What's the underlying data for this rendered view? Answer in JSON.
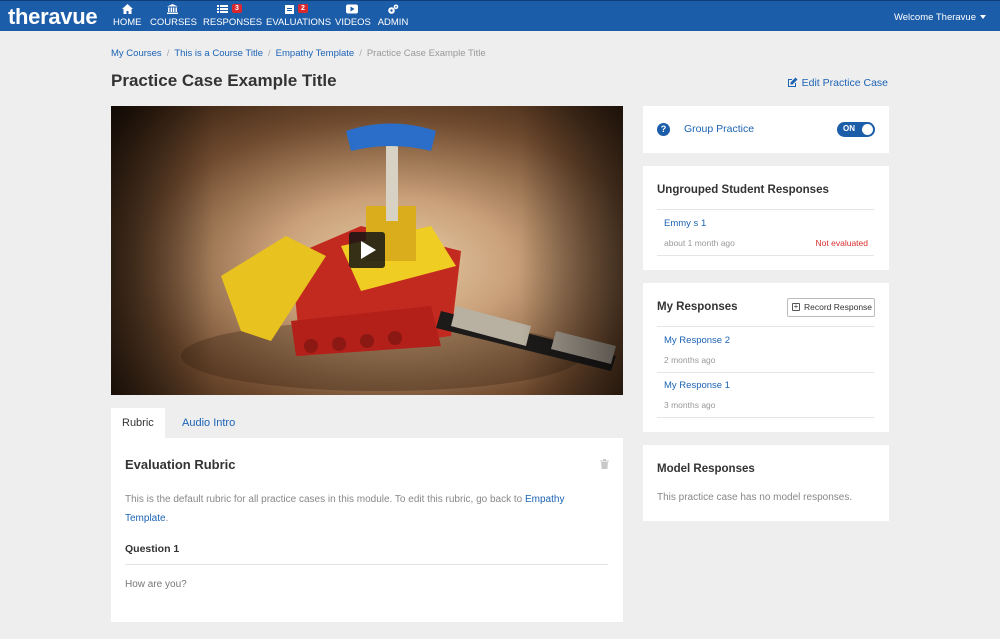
{
  "brand": {
    "logo": "theravue"
  },
  "nav": {
    "items": [
      {
        "label": "HOME",
        "icon": "home-icon"
      },
      {
        "label": "COURSES",
        "icon": "institution-icon"
      },
      {
        "label": "RESPONSES",
        "icon": "list-icon",
        "badge": "3"
      },
      {
        "label": "EVALUATIONS",
        "icon": "clipboard-icon",
        "badge": "2"
      },
      {
        "label": "VIDEOS",
        "icon": "play-icon"
      },
      {
        "label": "ADMIN",
        "icon": "gears-icon"
      }
    ],
    "welcome": "Welcome Theravue"
  },
  "breadcrumb": [
    "My Courses",
    "This is a Course Title",
    "Empathy Template",
    "Practice Case Example Title"
  ],
  "page": {
    "title": "Practice Case Example Title",
    "edit_label": "Edit Practice Case"
  },
  "tabs": [
    "Rubric",
    "Audio Intro"
  ],
  "rubric": {
    "title": "Evaluation Rubric",
    "description": "This is the default rubric for all practice cases in this module. To edit this rubric, go back to ",
    "description_link": "Empathy Template",
    "description_end": ".",
    "question_label": "Question 1",
    "question_text": "How are you?"
  },
  "group_practice": {
    "label": "Group Practice",
    "toggle": "ON"
  },
  "ungrouped": {
    "title": "Ungrouped Student Responses",
    "items": [
      {
        "name": "Emmy s 1",
        "time": "about 1 month ago",
        "status": "Not evaluated"
      }
    ]
  },
  "my_responses": {
    "title": "My Responses",
    "record_label": "Record Response",
    "items": [
      {
        "name": "My Response 2",
        "time": "2 months ago"
      },
      {
        "name": "My Response 1",
        "time": "3 months ago"
      }
    ]
  },
  "model_responses": {
    "title": "Model Responses",
    "empty_text": "This practice case has no model responses."
  },
  "colors": {
    "nav_bg": "#1c5da9",
    "link": "#1c63b4",
    "badge": "#d9282f",
    "status_bad": "#d9302e"
  }
}
